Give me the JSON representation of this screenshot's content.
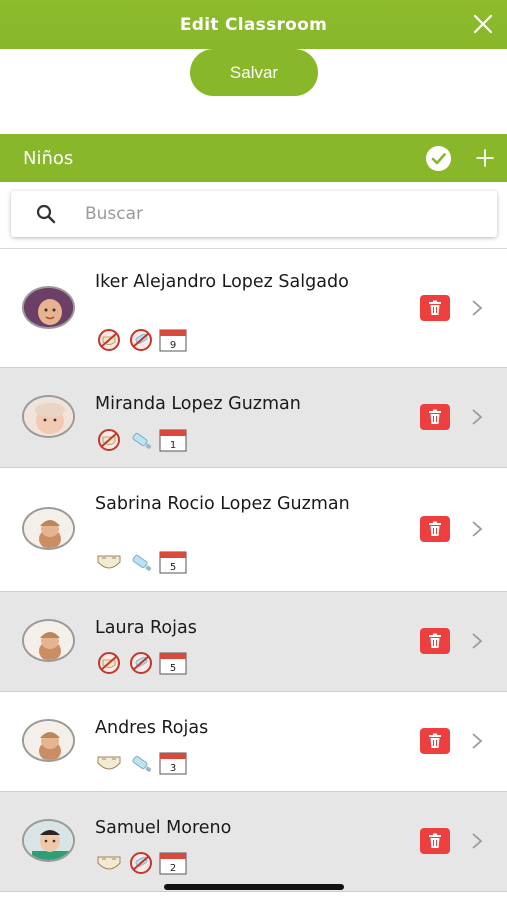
{
  "header": {
    "title": "Edit Classroom",
    "close_icon": "close-icon"
  },
  "save_button": {
    "label": "Salvar"
  },
  "section": {
    "label": "Niños",
    "check_icon": "check-circle-icon",
    "add_icon": "plus-icon"
  },
  "search": {
    "placeholder": "Buscar",
    "value": ""
  },
  "colors": {
    "accent": "#88b72a",
    "delete": "#ee3f3f",
    "row_alt": "#e6e6e6"
  },
  "children": [
    {
      "name": "Iker Alejandro Lopez Salgado",
      "icons": [
        "no-diaper",
        "no-bottle",
        "calendar"
      ],
      "calendar_day": "9"
    },
    {
      "name": "Miranda Lopez Guzman",
      "icons": [
        "no-diaper",
        "bottle",
        "calendar"
      ],
      "calendar_day": "1"
    },
    {
      "name": "Sabrina Rocio Lopez Guzman",
      "icons": [
        "diaper",
        "bottle",
        "calendar"
      ],
      "calendar_day": "5"
    },
    {
      "name": "Laura Rojas",
      "icons": [
        "no-diaper",
        "no-bottle",
        "calendar"
      ],
      "calendar_day": "5"
    },
    {
      "name": "Andres Rojas",
      "icons": [
        "diaper",
        "bottle",
        "calendar"
      ],
      "calendar_day": "3"
    },
    {
      "name": "Samuel Moreno",
      "icons": [
        "diaper",
        "no-bottle",
        "calendar"
      ],
      "calendar_day": "2"
    }
  ]
}
